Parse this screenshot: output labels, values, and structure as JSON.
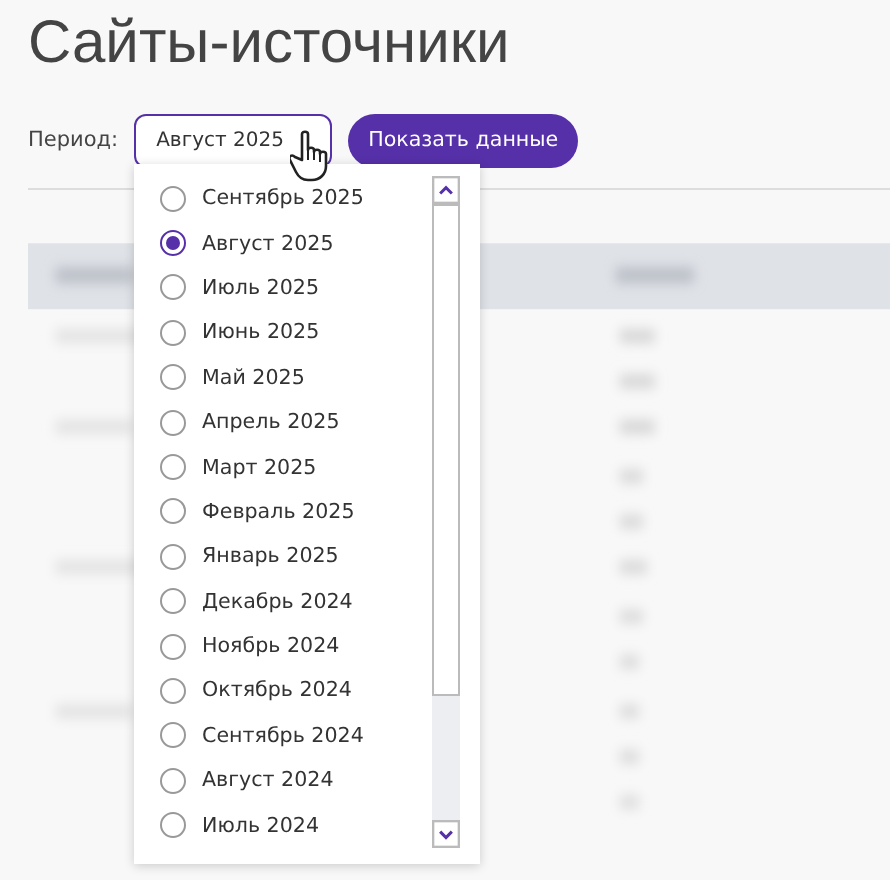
{
  "title": "Сайты-источники",
  "period": {
    "label": "Период:",
    "value": "Август 2025",
    "expanded": true
  },
  "show_button": "Показать данные",
  "dropdown": {
    "options": [
      {
        "label": "Сентябрь 2025",
        "selected": false
      },
      {
        "label": "Август 2025",
        "selected": true
      },
      {
        "label": "Июль 2025",
        "selected": false
      },
      {
        "label": "Июнь 2025",
        "selected": false
      },
      {
        "label": "Май 2025",
        "selected": false
      },
      {
        "label": "Апрель 2025",
        "selected": false
      },
      {
        "label": "Март 2025",
        "selected": false
      },
      {
        "label": "Февраль 2025",
        "selected": false
      },
      {
        "label": "Январь 2025",
        "selected": false
      },
      {
        "label": "Декабрь 2024",
        "selected": false
      },
      {
        "label": "Ноябрь 2024",
        "selected": false
      },
      {
        "label": "Октябрь 2024",
        "selected": false
      },
      {
        "label": "Сентябрь 2024",
        "selected": false
      },
      {
        "label": "Август 2024",
        "selected": false
      },
      {
        "label": "Июль 2024",
        "selected": false
      }
    ]
  }
}
